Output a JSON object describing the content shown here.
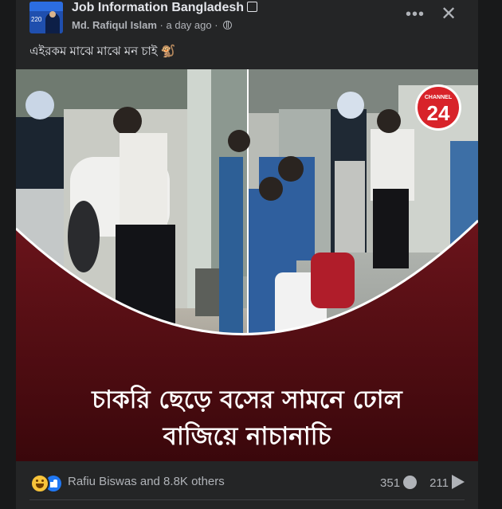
{
  "post": {
    "page_name": "Job Information Bangladesh",
    "verified_glyph": "☑",
    "avatar_badge": "220",
    "author": "Md. Rafiqul Islam",
    "time": "a day ago",
    "separator": "·",
    "audience_icon": "globe-icon",
    "more_icon": "•••",
    "close_icon": "✕",
    "caption": "এইরকম মাঝে মাঝে মন চাই 🐒"
  },
  "media": {
    "headline_line1": "চাকরি ছেড়ে বসের সামনে ঢোল",
    "headline_line2": "বাজিয়ে নাচানাচি",
    "channel_label": "CHANNEL",
    "channel_number": "24",
    "colors": {
      "banner": "#5a1116",
      "logo_red": "#d8232a",
      "headline": "#ffffff"
    }
  },
  "reactions": {
    "icons": [
      "haha-icon",
      "like-icon"
    ],
    "text": "Rafiu Biswas and 8.8K others",
    "comments_count": "351",
    "shares_count": "211"
  }
}
